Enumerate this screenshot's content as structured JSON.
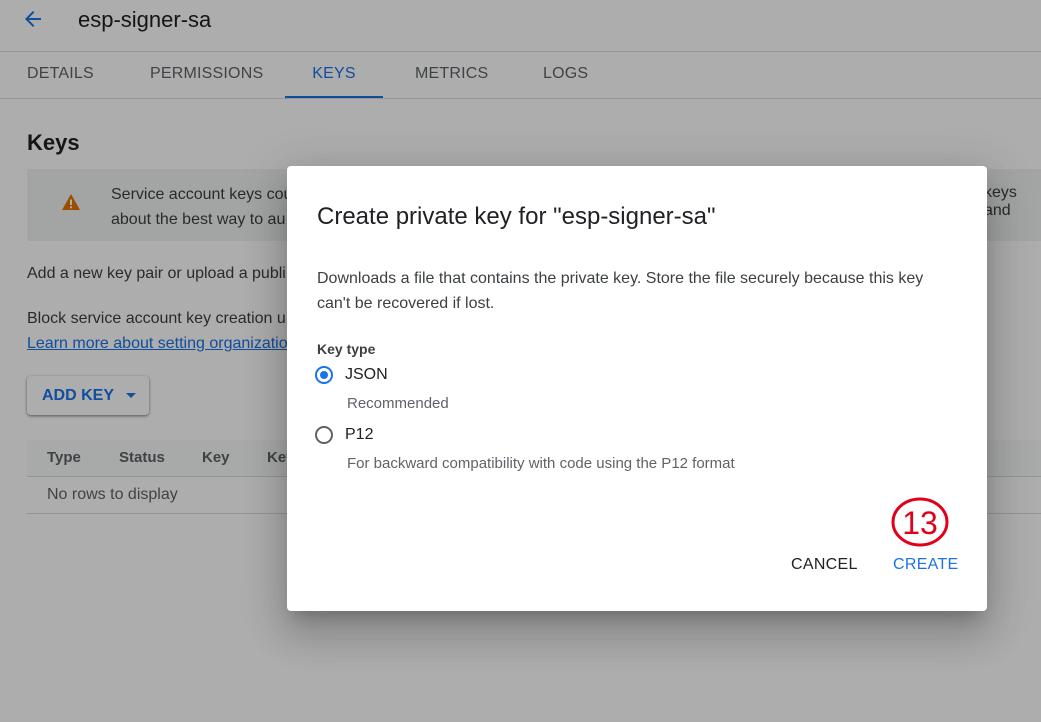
{
  "header": {
    "title": "esp-signer-sa"
  },
  "tabs": [
    {
      "label": "DETAILS"
    },
    {
      "label": "PERMISSIONS"
    },
    {
      "label": "KEYS"
    },
    {
      "label": "METRICS"
    },
    {
      "label": "LOGS"
    }
  ],
  "active_tab": "KEYS",
  "keys_section": {
    "title": "Keys",
    "warning_line1": "Service account keys cou",
    "warning_line2": "about the best way to au",
    "warning_right": "keys and",
    "add_pair_text": "Add a new key pair or upload a publi",
    "block_text": "Block service account key creation u",
    "learn_more_link": "Learn more about setting organizatio",
    "add_key_label": "ADD KEY",
    "table": {
      "columns": [
        "Type",
        "Status",
        "Key",
        "Key"
      ],
      "empty_text": "No rows to display"
    }
  },
  "dialog": {
    "title": "Create private key for \"esp-signer-sa\"",
    "description": "Downloads a file that contains the private key. Store the file securely because this key can't be recovered if lost.",
    "key_type_label": "Key type",
    "options": [
      {
        "label": "JSON",
        "help": "Recommended",
        "selected": true
      },
      {
        "label": "P12",
        "help": "For backward compatibility with code using the P12 format",
        "selected": false
      }
    ],
    "cancel_label": "CANCEL",
    "create_label": "CREATE",
    "step_annotation": "13"
  },
  "colors": {
    "accent": "#1a73e8",
    "warning": "#e37400",
    "annotation": "#e0001b"
  }
}
